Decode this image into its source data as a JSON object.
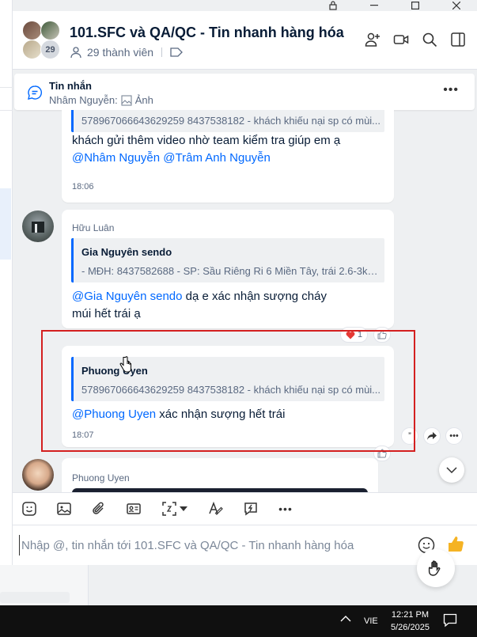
{
  "window": {
    "controls": [
      "lock",
      "minimize",
      "maximize",
      "close"
    ]
  },
  "header": {
    "title": "101.SFC và QA/QC - Tin nhanh hàng hóa",
    "avatar_count": "29",
    "members": "29 thành viên"
  },
  "pinned": {
    "title": "Tin nhắn",
    "sender": "Nhâm Nguyễn:",
    "content": "Ảnh"
  },
  "messages": {
    "m1": {
      "quote_text": "578967066643629259 8437538182 - khách khiếu nại sp có mùi...",
      "line1": "khách gửi thêm video nhờ team kiểm tra giúp em ạ",
      "mention1": "@Nhâm Nguyễn",
      "mention2": "@Trâm Anh Nguyễn",
      "time": "18:06"
    },
    "m2": {
      "sender": "Hữu Luân",
      "quote_name": "Gia Nguyên sendo",
      "quote_text": "- MĐH: 8437582688 - SP: Sầu Riêng Ri 6 Miền Tây, trái 2.6-3kg ...",
      "mention": "@Gia Nguyên sendo",
      "text_after": " dạ e xác nhận sượng cháy",
      "line2": "múi hết trái ạ",
      "reaction_count": "1"
    },
    "m3": {
      "quote_name": "Phuong Uyen",
      "quote_text": "578967066643629259 8437538182 - khách khiếu nại sp có mùi...",
      "mention": "@Phuong Uyen",
      "text_after": " xác nhận sượng hết trái",
      "time": "18:07"
    },
    "m4": {
      "sender": "Phuong Uyen"
    }
  },
  "composer": {
    "placeholder": "Nhập @, tin nhắn tới 101.SFC và QA/QC - Tin nhanh hàng hóa"
  },
  "taskbar": {
    "lang": "VIE",
    "time": "12:21 PM",
    "date": "5/26/2025"
  },
  "colors": {
    "accent": "#0068ff",
    "highlight": "#d42020",
    "heart": "#e53935"
  }
}
